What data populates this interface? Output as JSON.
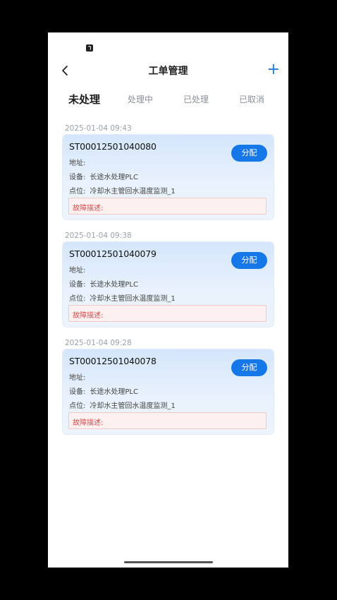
{
  "nav": {
    "title": "工单管理",
    "add_label": "+"
  },
  "tabs": [
    {
      "label": "未处理",
      "active": true
    },
    {
      "label": "处理中",
      "active": false
    },
    {
      "label": "已处理",
      "active": false
    },
    {
      "label": "已取消",
      "active": false
    }
  ],
  "orders": [
    {
      "time": "2025-01-04 09:43",
      "id": "ST00012501040080",
      "assign_label": "分配",
      "address_label": "地址:",
      "address_value": "",
      "device_label": "设备:",
      "device_value": "长途水处理PLC",
      "point_label": "点位:",
      "point_value": "冷却水主管回水温度监测_1",
      "fault_label": "故障描述:"
    },
    {
      "time": "2025-01-04 09:38",
      "id": "ST00012501040079",
      "assign_label": "分配",
      "address_label": "地址:",
      "address_value": "",
      "device_label": "设备:",
      "device_value": "长途水处理PLC",
      "point_label": "点位:",
      "point_value": "冷却水主管回水温度监测_1",
      "fault_label": "故障描述:"
    },
    {
      "time": "2025-01-04 09:28",
      "id": "ST00012501040078",
      "assign_label": "分配",
      "address_label": "地址:",
      "address_value": "",
      "device_label": "设备:",
      "device_value": "长途水处理PLC",
      "point_label": "点位:",
      "point_value": "冷却水主管回水温度监测_1",
      "fault_label": "故障描述:"
    }
  ],
  "colors": {
    "accent": "#1677e8",
    "fault_text": "#e04848",
    "fault_bg": "#fdf0f0"
  }
}
